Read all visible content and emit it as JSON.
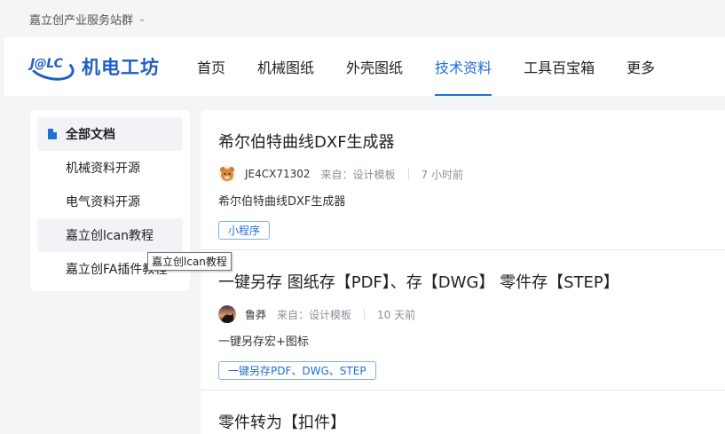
{
  "topbar": {
    "site_group": "嘉立创产业服务站群"
  },
  "logo": {
    "badge": "J@LC",
    "name": "机电工坊"
  },
  "nav": {
    "items": [
      {
        "label": "首页"
      },
      {
        "label": "机械图纸"
      },
      {
        "label": "外壳图纸"
      },
      {
        "label": "技术资料",
        "active": true
      },
      {
        "label": "工具百宝箱"
      },
      {
        "label": "更多"
      }
    ]
  },
  "sidebar": {
    "items": [
      {
        "label": "全部文档"
      },
      {
        "label": "机械资料开源"
      },
      {
        "label": "电气资料开源"
      },
      {
        "label": "嘉立创lcan教程"
      },
      {
        "label": "嘉立创FA插件教程"
      }
    ],
    "tooltip": "嘉立创lcan教程"
  },
  "articles": [
    {
      "title": "希尔伯特曲线DXF生成器",
      "author": "JE4CX71302",
      "source": "来自：设计模板",
      "time": "7 小时前",
      "desc": "希尔伯特曲线DXF生成器",
      "tag": "小程序"
    },
    {
      "title": "一键另存 图纸存【PDF】、存【DWG】 零件存【STEP】",
      "author": "鲁莽",
      "source": "来自：设计模板",
      "time": "10 天前",
      "desc": "一键另存宏+图标",
      "tag": "一键另存PDF、DWG、STEP"
    },
    {
      "title": "零件转为【扣件】"
    }
  ],
  "colors": {
    "brand": "#1f5fc4",
    "accent": "#1f6fd6",
    "page_bg": "#f4f5f7"
  }
}
